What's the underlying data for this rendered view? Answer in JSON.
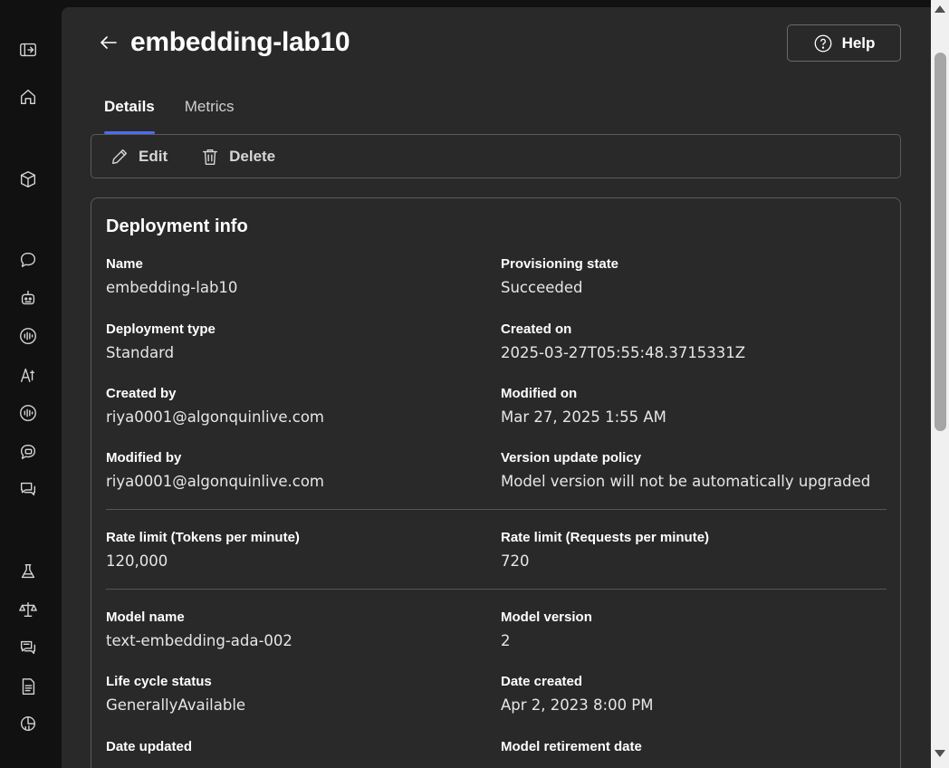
{
  "rail": {
    "icons": [
      "panel-toggle-icon",
      "home-icon",
      "cube-icon",
      "chat-icon",
      "robot-icon",
      "audio-icon",
      "text-icon",
      "speech-icon",
      "image-chat-icon",
      "chat-bubbles-icon",
      "flask-icon",
      "scale-icon",
      "chat-history-icon",
      "document-icon",
      "analytics-icon"
    ]
  },
  "header": {
    "title": "embedding-lab10",
    "help_label": "Help"
  },
  "tabs": [
    {
      "label": "Details",
      "active": true
    },
    {
      "label": "Metrics",
      "active": false
    }
  ],
  "toolbar": {
    "edit_label": "Edit",
    "delete_label": "Delete"
  },
  "card": {
    "title": "Deployment info",
    "fields": {
      "name": {
        "label": "Name",
        "value": "embedding-lab10"
      },
      "provisioning_state": {
        "label": "Provisioning state",
        "value": "Succeeded"
      },
      "deployment_type": {
        "label": "Deployment type",
        "value": "Standard"
      },
      "created_on": {
        "label": "Created on",
        "value": "2025-03-27T05:55:48.3715331Z"
      },
      "created_by": {
        "label": "Created by",
        "value": "riya0001@algonquinlive.com"
      },
      "modified_on": {
        "label": "Modified on",
        "value": "Mar 27, 2025 1:55 AM"
      },
      "modified_by": {
        "label": "Modified by",
        "value": "riya0001@algonquinlive.com"
      },
      "version_update_policy": {
        "label": "Version update policy",
        "value": "Model version will not be automatically upgraded"
      },
      "rate_limit_tpm": {
        "label": "Rate limit (Tokens per minute)",
        "value": "120,000"
      },
      "rate_limit_rpm": {
        "label": "Rate limit (Requests per minute)",
        "value": "720"
      },
      "model_name": {
        "label": "Model name",
        "value": "text-embedding-ada-002"
      },
      "model_version": {
        "label": "Model version",
        "value": "2"
      },
      "life_cycle_status": {
        "label": "Life cycle status",
        "value": "GenerallyAvailable"
      },
      "date_created": {
        "label": "Date created",
        "value": "Apr 2, 2023 8:00 PM"
      },
      "date_updated": {
        "label": "Date updated",
        "value": ""
      },
      "model_retirement_date": {
        "label": "Model retirement date",
        "value": ""
      }
    }
  },
  "colors": {
    "accent": "#4f6bed",
    "panel_bg": "#292929",
    "page_bg": "#111111"
  }
}
